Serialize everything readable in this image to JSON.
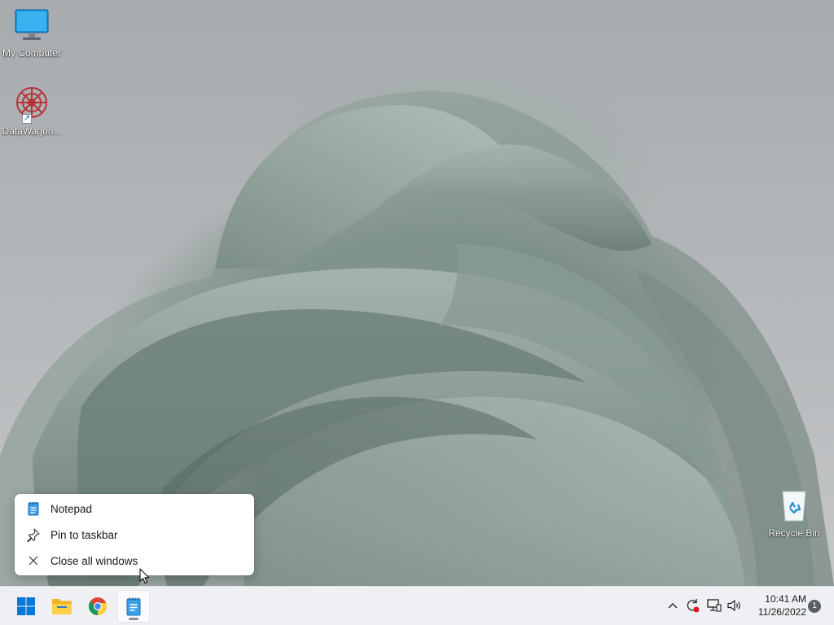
{
  "desktop": {
    "icons": [
      {
        "label": "My Computer",
        "icon": "monitor-icon"
      },
      {
        "label": "DataWagon...",
        "icon": "datawagon-logo-icon"
      },
      {
        "label": "Recycle Bin",
        "icon": "recycle-bin-icon"
      }
    ]
  },
  "context_menu": {
    "items": [
      {
        "label": "Notepad",
        "icon": "notepad-icon"
      },
      {
        "label": "Pin to taskbar",
        "icon": "pin-icon"
      },
      {
        "label": "Close all windows",
        "icon": "close-icon"
      }
    ]
  },
  "taskbar": {
    "apps": [
      {
        "name": "start",
        "icon": "windows-logo-icon"
      },
      {
        "name": "file-explorer",
        "icon": "folder-icon"
      },
      {
        "name": "chrome",
        "icon": "chrome-icon"
      },
      {
        "name": "notepad",
        "icon": "notepad-icon",
        "running": true
      }
    ],
    "tray": {
      "time": "10:41 AM",
      "date": "11/26/2022",
      "notification_count": "1"
    }
  },
  "colors": {
    "taskbar_bg": "#eef0f3",
    "menu_bg": "#ffffff",
    "win_blue": "#0a78d4",
    "badge_bg": "#5b5f66",
    "alert_red": "#e81123"
  }
}
